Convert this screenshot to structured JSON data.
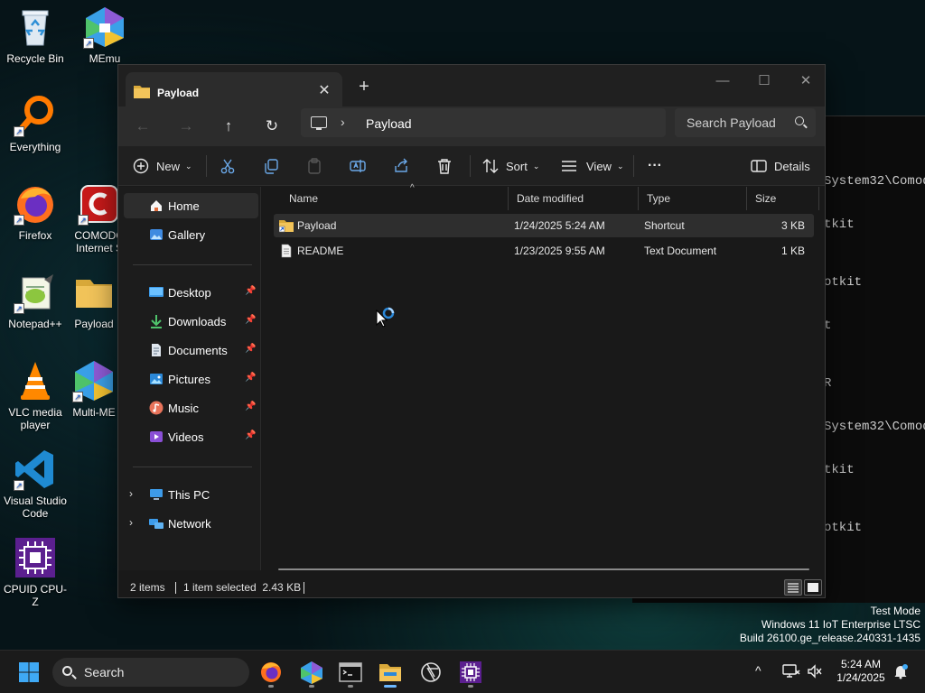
{
  "desktop": {
    "icons": [
      {
        "label": "Recycle Bin"
      },
      {
        "label": "MEmu"
      },
      {
        "label": "Everything"
      },
      {
        "label": "Firefox"
      },
      {
        "label": "COMODO Internet S"
      },
      {
        "label": "Notepad++"
      },
      {
        "label": "Payload"
      },
      {
        "label": "VLC media player"
      },
      {
        "label": "Multi-ME"
      },
      {
        "label": "Visual Studio Code"
      },
      {
        "label": "CPUID CPU-Z"
      }
    ]
  },
  "terminal": {
    "lines": [
      "System32\\Comod",
      "tkit",
      "otkit",
      "t",
      "R",
      "System32\\Comod",
      "tkit",
      "otkit"
    ]
  },
  "explorer": {
    "tab_title": "Payload",
    "tab_close": "✕",
    "new_tab": "+",
    "window_buttons": {
      "minimize": "—",
      "maximize": "☐",
      "close": "✕"
    },
    "nav": {
      "back": "←",
      "forward": "→",
      "up": "↑",
      "refresh": "↻"
    },
    "address": {
      "chevron": "›",
      "crumb": "Payload"
    },
    "search_placeholder": "Search Payload",
    "toolbar": {
      "new_label": "New",
      "sort_label": "Sort",
      "view_label": "View",
      "more_label": "···",
      "details_label": "Details"
    },
    "sidebar": {
      "top": [
        {
          "label": "Home",
          "selected": true
        },
        {
          "label": "Gallery"
        }
      ],
      "pinned": [
        {
          "label": "Desktop"
        },
        {
          "label": "Downloads"
        },
        {
          "label": "Documents"
        },
        {
          "label": "Pictures"
        },
        {
          "label": "Music"
        },
        {
          "label": "Videos"
        }
      ],
      "bottom": [
        {
          "label": "This PC"
        },
        {
          "label": "Network"
        }
      ],
      "pin_glyph": "📌",
      "expand_glyph": "›"
    },
    "columns": {
      "name": "Name",
      "date": "Date modified",
      "type": "Type",
      "size": "Size",
      "sort_caret": "^"
    },
    "files": [
      {
        "name": "Payload",
        "date": "1/24/2025 5:24 AM",
        "type": "Shortcut",
        "size": "3 KB",
        "selected": true
      },
      {
        "name": "README",
        "date": "1/23/2025 9:55 AM",
        "type": "Text Document",
        "size": "1 KB"
      }
    ],
    "status": {
      "items": "2 items",
      "selection": "1 item selected  2.43 KB"
    }
  },
  "watermark": {
    "line1": "Test Mode",
    "line2": "Windows 11 IoT Enterprise LTSC",
    "line3": "Build 26100.ge_release.240331-1435"
  },
  "taskbar": {
    "search_label": "Search",
    "time": "5:24 AM",
    "date": "1/24/2025",
    "chevron": "^"
  },
  "colors": {
    "accent": "#0078d4",
    "folder_yellow": "#f2c45a",
    "window_bg": "#191919"
  }
}
